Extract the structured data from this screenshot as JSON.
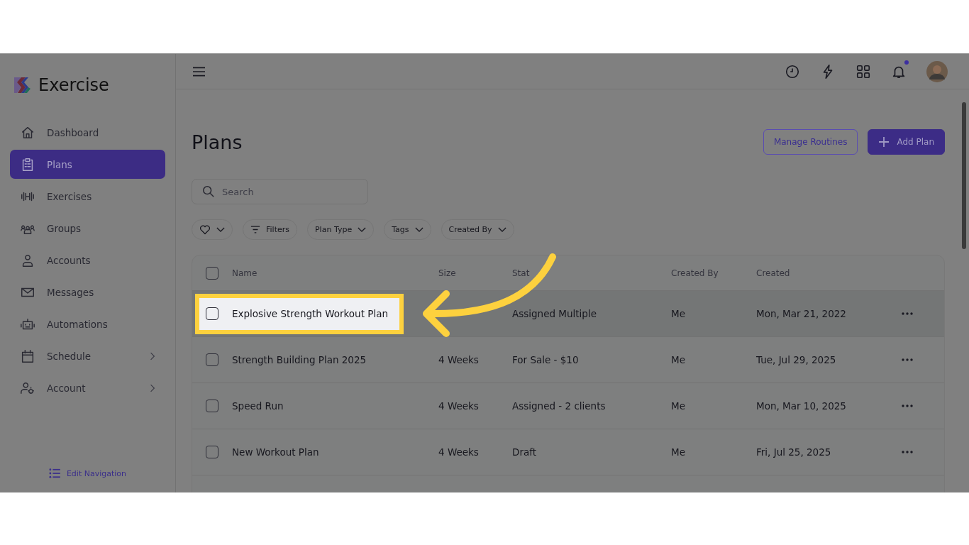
{
  "brand": {
    "name": "Exercise"
  },
  "sidebar": {
    "items": [
      {
        "label": "Dashboard",
        "selected": false,
        "kind": "link"
      },
      {
        "label": "Plans",
        "selected": true,
        "kind": "link"
      },
      {
        "label": "Exercises",
        "selected": false,
        "kind": "link"
      },
      {
        "label": "Groups",
        "selected": false,
        "kind": "link"
      },
      {
        "label": "Accounts",
        "selected": false,
        "kind": "link"
      },
      {
        "label": "Messages",
        "selected": false,
        "kind": "link"
      },
      {
        "label": "Automations",
        "selected": false,
        "kind": "link"
      },
      {
        "label": "Schedule",
        "selected": false,
        "kind": "submenu"
      },
      {
        "label": "Account",
        "selected": false,
        "kind": "submenu"
      }
    ],
    "footer_link": "Edit Navigation"
  },
  "topbar": {
    "notification_badge": true
  },
  "page": {
    "title": "Plans",
    "buttons": [
      {
        "label": "Manage Routines",
        "kind": "outline"
      },
      {
        "label": "Add Plan",
        "kind": "primary"
      }
    ],
    "search": {
      "placeholder": "Search"
    },
    "filters": [
      {
        "kind": "favorite"
      },
      {
        "label": "Filters",
        "kind": "filter"
      },
      {
        "label": "Plan Type",
        "kind": "dropdown"
      },
      {
        "label": "Tags",
        "kind": "dropdown"
      },
      {
        "label": "Created By",
        "kind": "dropdown"
      }
    ]
  },
  "table": {
    "all_checked": false,
    "columns": [
      "Name",
      "Size",
      "Stat",
      "Created By",
      "Created"
    ],
    "rows": [
      {
        "checked": false,
        "highlighted": true,
        "name": "Explosive Strength Workout Plan",
        "status": "Assigned Multiple",
        "created_by": "Me",
        "created": "Mon, Mar 21, 2022"
      },
      {
        "checked": false,
        "highlighted": false,
        "name": "Strength Building Plan 2025",
        "size": "4 Weeks",
        "status": "For Sale - $10",
        "created_by": "Me",
        "created": "Tue, Jul 29, 2025"
      },
      {
        "checked": false,
        "highlighted": false,
        "name": "Speed Run",
        "size": "4 Weeks",
        "status": "Assigned - 2 clients",
        "created_by": "Me",
        "created": "Mon, Mar 10, 2025"
      },
      {
        "checked": false,
        "highlighted": false,
        "name": "New Workout Plan",
        "size": "4 Weeks",
        "status": "Draft",
        "created_by": "Me",
        "created": "Fri, Jul 25, 2025"
      }
    ]
  }
}
